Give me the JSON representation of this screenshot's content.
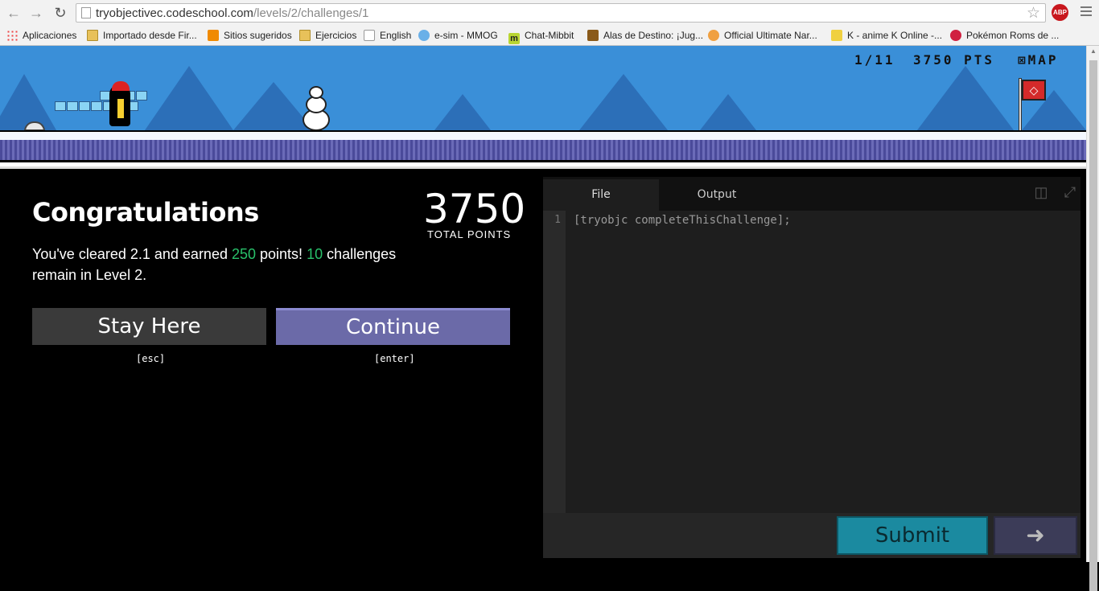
{
  "browser": {
    "url_host": "tryobjectivec.codeschool.com",
    "url_path": "/levels/2/challenges/1",
    "abp_label": "ABP",
    "bookmarks": [
      {
        "label": "Aplicaciones",
        "icon": "apps-icon"
      },
      {
        "label": "Importado desde Fir...",
        "icon": "folder-icon"
      },
      {
        "label": "Sitios sugeridos",
        "icon": "bulb-icon"
      },
      {
        "label": "Ejercicios",
        "icon": "folder-icon"
      },
      {
        "label": "English",
        "icon": "page-icon"
      },
      {
        "label": "e-sim - MMOG",
        "icon": "globe-icon"
      },
      {
        "label": "Chat-Mibbit",
        "icon": "mibbit-icon"
      },
      {
        "label": "Alas de Destino: ¡Jug...",
        "icon": "game-icon"
      },
      {
        "label": "Official Ultimate Nar...",
        "icon": "face-icon"
      },
      {
        "label": "K - anime K Online -...",
        "icon": "k-icon"
      },
      {
        "label": "Pokémon Roms de ...",
        "icon": "pokeball-icon"
      }
    ]
  },
  "hud": {
    "progress": "1/11",
    "points": "3750 PTS",
    "map": "MAP"
  },
  "results": {
    "title": "Congratulations",
    "total_points": "3750",
    "total_points_label": "TOTAL POINTS",
    "msg_prefix": "You've cleared 2.1 and earned ",
    "earned": "250",
    "msg_mid": " points! ",
    "remaining": "10",
    "msg_suffix": " challenges remain in Level 2.",
    "stay_label": "Stay Here",
    "stay_hint": "[esc]",
    "continue_label": "Continue",
    "continue_hint": "[enter]"
  },
  "editor": {
    "tabs": [
      "File",
      "Output"
    ],
    "line_number": "1",
    "code": "[tryobjc completeThisChallenge];",
    "submit_label": "Submit",
    "next_icon": "➜"
  },
  "colors": {
    "highlight": "#29c06a",
    "continue_bg": "#6b6aa8",
    "submit_bg": "#1b8aa0",
    "sky": "#3a8fd8"
  }
}
